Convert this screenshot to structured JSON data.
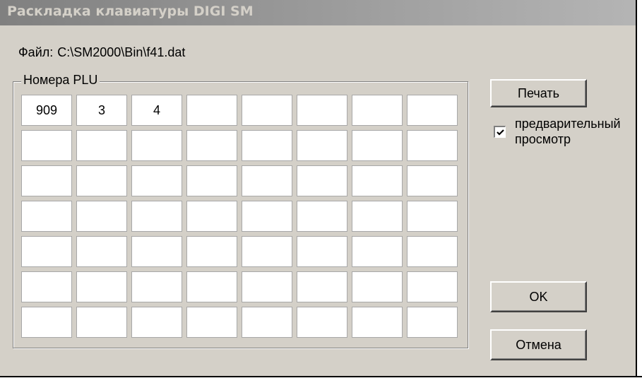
{
  "window": {
    "title": "Раскладка клавиатуры DIGI SM"
  },
  "file": {
    "label": "Файл:",
    "path": "C:\\SM2000\\Bin\\f41.dat"
  },
  "plu_group": {
    "title": "Номера PLU",
    "rows": [
      [
        "909",
        "3",
        "4",
        "",
        "",
        "",
        "",
        ""
      ],
      [
        "",
        "",
        "",
        "",
        "",
        "",
        "",
        ""
      ],
      [
        "",
        "",
        "",
        "",
        "",
        "",
        "",
        ""
      ],
      [
        "",
        "",
        "",
        "",
        "",
        "",
        "",
        ""
      ],
      [
        "",
        "",
        "",
        "",
        "",
        "",
        "",
        ""
      ],
      [
        "",
        "",
        "",
        "",
        "",
        "",
        "",
        ""
      ],
      [
        "",
        "",
        "",
        "",
        "",
        "",
        "",
        ""
      ]
    ]
  },
  "print_button": {
    "label": "Печать"
  },
  "preview_checkbox": {
    "checked": true,
    "label_line1": "предварительный",
    "label_line2": "просмотр"
  },
  "ok_button": {
    "label": "OK"
  },
  "cancel_button": {
    "label": "Отмена"
  }
}
